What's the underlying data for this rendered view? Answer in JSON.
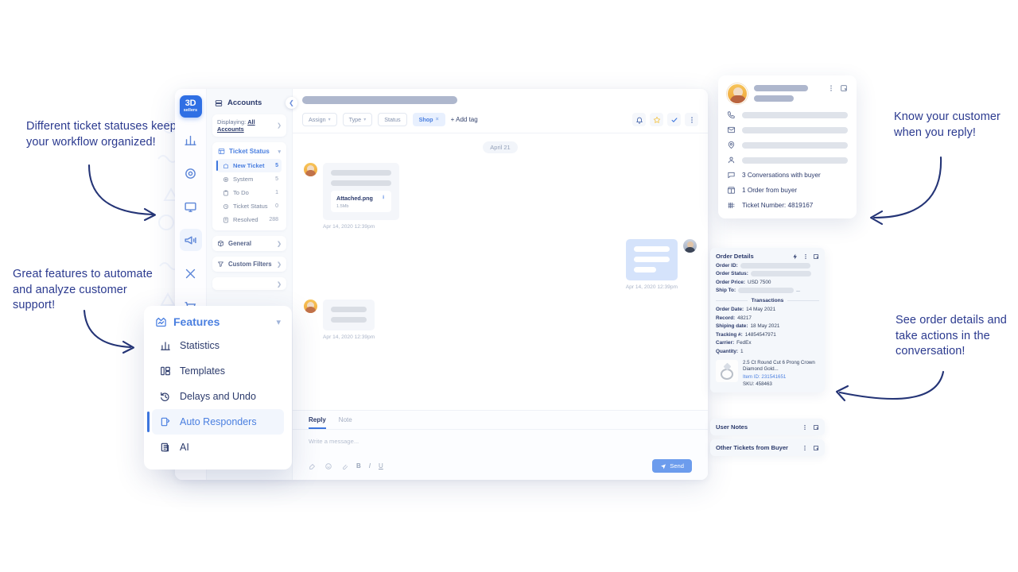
{
  "callouts": [
    {
      "id": "statuses",
      "text": "Different ticket statuses keep\nyour workflow organized!"
    },
    {
      "id": "features",
      "text": "Great features to automate\nand analyze customer support!"
    },
    {
      "id": "customer",
      "text": "Know your customer\nwhen you reply!"
    },
    {
      "id": "order",
      "text": "See order details and\ntake actions in the\nconversation!"
    }
  ],
  "brand": {
    "logo_line1": "3D",
    "logo_line2": "sellers",
    "accent": "#3d76de",
    "blue": "#4a7fe0",
    "navy": "#2b3a6b"
  },
  "rail": {
    "items": [
      {
        "name": "statistics-icon",
        "label": "Statistics"
      },
      {
        "name": "support-icon",
        "label": "Support"
      },
      {
        "name": "monitor-icon",
        "label": "Monitor"
      },
      {
        "name": "megaphone-icon",
        "label": "Campaigns"
      },
      {
        "name": "tools-icon",
        "label": "Tools"
      },
      {
        "name": "cart-icon",
        "label": "Orders"
      }
    ],
    "active_index": 3
  },
  "sidebar": {
    "header": "Accounts",
    "displaying_label": "Displaying:",
    "displaying_value": "All Accounts",
    "group": {
      "label": "Ticket Status"
    },
    "status_items": [
      {
        "label": "New Ticket",
        "count": "5",
        "icon": "new-ticket-icon",
        "active": true
      },
      {
        "label": "System",
        "count": "5",
        "icon": "system-icon",
        "active": false
      },
      {
        "label": "To Do",
        "count": "1",
        "icon": "todo-icon",
        "active": false
      },
      {
        "label": "Ticket Status",
        "count": "0",
        "icon": "clock-icon",
        "active": false
      },
      {
        "label": "Resolved",
        "count": "288",
        "icon": "resolved-icon",
        "active": false
      }
    ],
    "links": [
      {
        "label": "General",
        "icon": "box-icon"
      },
      {
        "label": "Custom Filters",
        "icon": "filter-icon"
      }
    ]
  },
  "conversation": {
    "day_divider": "April 21",
    "chips": [
      {
        "label": "Assign",
        "type": "dropdown"
      },
      {
        "label": "Type",
        "type": "dropdown"
      },
      {
        "label": "Status",
        "type": "plain"
      }
    ],
    "tag": {
      "label": "Shop",
      "remove": "×"
    },
    "add_tag": "+ Add tag",
    "actions": [
      {
        "name": "bell-icon",
        "label": "Notifications"
      },
      {
        "name": "star-icon",
        "label": "Favorite"
      },
      {
        "name": "check-icon",
        "label": "Resolve"
      },
      {
        "name": "more-vertical-icon",
        "label": "More"
      }
    ],
    "messages": [
      {
        "side": "in",
        "attachment": {
          "name": "Attached.png",
          "size": "1.5Mb"
        },
        "timestamp": "Apr 14, 2020 12:39pm"
      },
      {
        "side": "out",
        "timestamp": "Apr 14, 2020 12:39pm"
      },
      {
        "side": "in",
        "timestamp": "Apr 14, 2020 12:39pm"
      }
    ]
  },
  "reply": {
    "tabs": [
      {
        "label": "Reply",
        "active": true
      },
      {
        "label": "Note",
        "active": false
      }
    ],
    "placeholder": "Write a message...",
    "tools": [
      {
        "name": "template-icon"
      },
      {
        "name": "emoji-icon"
      },
      {
        "name": "attach-icon"
      },
      {
        "name": "bold-icon",
        "glyph": "B"
      },
      {
        "name": "italic-icon",
        "glyph": "I"
      },
      {
        "name": "underline-icon",
        "glyph": "U"
      }
    ],
    "send_label": "Send"
  },
  "customer_panel": {
    "rows": [
      {
        "icon": "phone-icon",
        "masked": true
      },
      {
        "icon": "mail-icon",
        "masked": true
      },
      {
        "icon": "location-icon",
        "masked": true
      },
      {
        "icon": "user-icon",
        "masked": true
      },
      {
        "icon": "chat-icon",
        "text": "3 Conversations with buyer"
      },
      {
        "icon": "package-icon",
        "text": "1 Order from buyer"
      },
      {
        "icon": "tally-icon",
        "text": "Ticket Number: 4819167"
      }
    ],
    "actions": [
      {
        "name": "more-vertical-icon"
      },
      {
        "name": "expand-icon"
      }
    ]
  },
  "order_details": {
    "title": "Order Details",
    "actions": [
      {
        "name": "bolt-icon"
      },
      {
        "name": "more-vertical-icon"
      },
      {
        "name": "expand-icon"
      }
    ],
    "fields": [
      {
        "label": "Order ID:",
        "value": "",
        "masked": true
      },
      {
        "label": "Order Status:",
        "value": "",
        "masked": true
      },
      {
        "label": "Order Price:",
        "value": "USD 7500",
        "masked": false
      },
      {
        "label": "Ship To:",
        "value": "",
        "masked": true,
        "ellipsis": "..."
      }
    ],
    "transactions_label": "Transactions",
    "transactions": [
      {
        "label": "Order Date:",
        "value": "14 May 2021"
      },
      {
        "label": "Record:",
        "value": "48217"
      },
      {
        "label": "Shiping date:",
        "value": "18 May 2021"
      },
      {
        "label": "Tracking #:",
        "value": "14854547971"
      },
      {
        "label": "Carrier:",
        "value": "FedEx"
      },
      {
        "label": "Quantity:",
        "value": "1"
      }
    ],
    "product": {
      "name": "2.5 Ct Round Cut 6 Prong Crown Diamond Gold...",
      "item_id_label": "Item ID:",
      "item_id": "231541651",
      "sku_label": "SKU:",
      "sku": "458463"
    }
  },
  "user_notes": {
    "title": "User Notes"
  },
  "other_tickets": {
    "title": "Other Tickets from Buyer"
  },
  "features_menu": {
    "title": "Features",
    "items": [
      {
        "label": "Statistics",
        "icon": "bar-chart-icon",
        "active": false
      },
      {
        "label": "Templates",
        "icon": "templates-icon",
        "active": false
      },
      {
        "label": "Delays and Undo",
        "icon": "undo-clock-icon",
        "active": false
      },
      {
        "label": "Auto Responders",
        "icon": "auto-responders-icon",
        "active": true
      },
      {
        "label": "AI",
        "icon": "ai-copy-icon",
        "active": false
      }
    ]
  }
}
